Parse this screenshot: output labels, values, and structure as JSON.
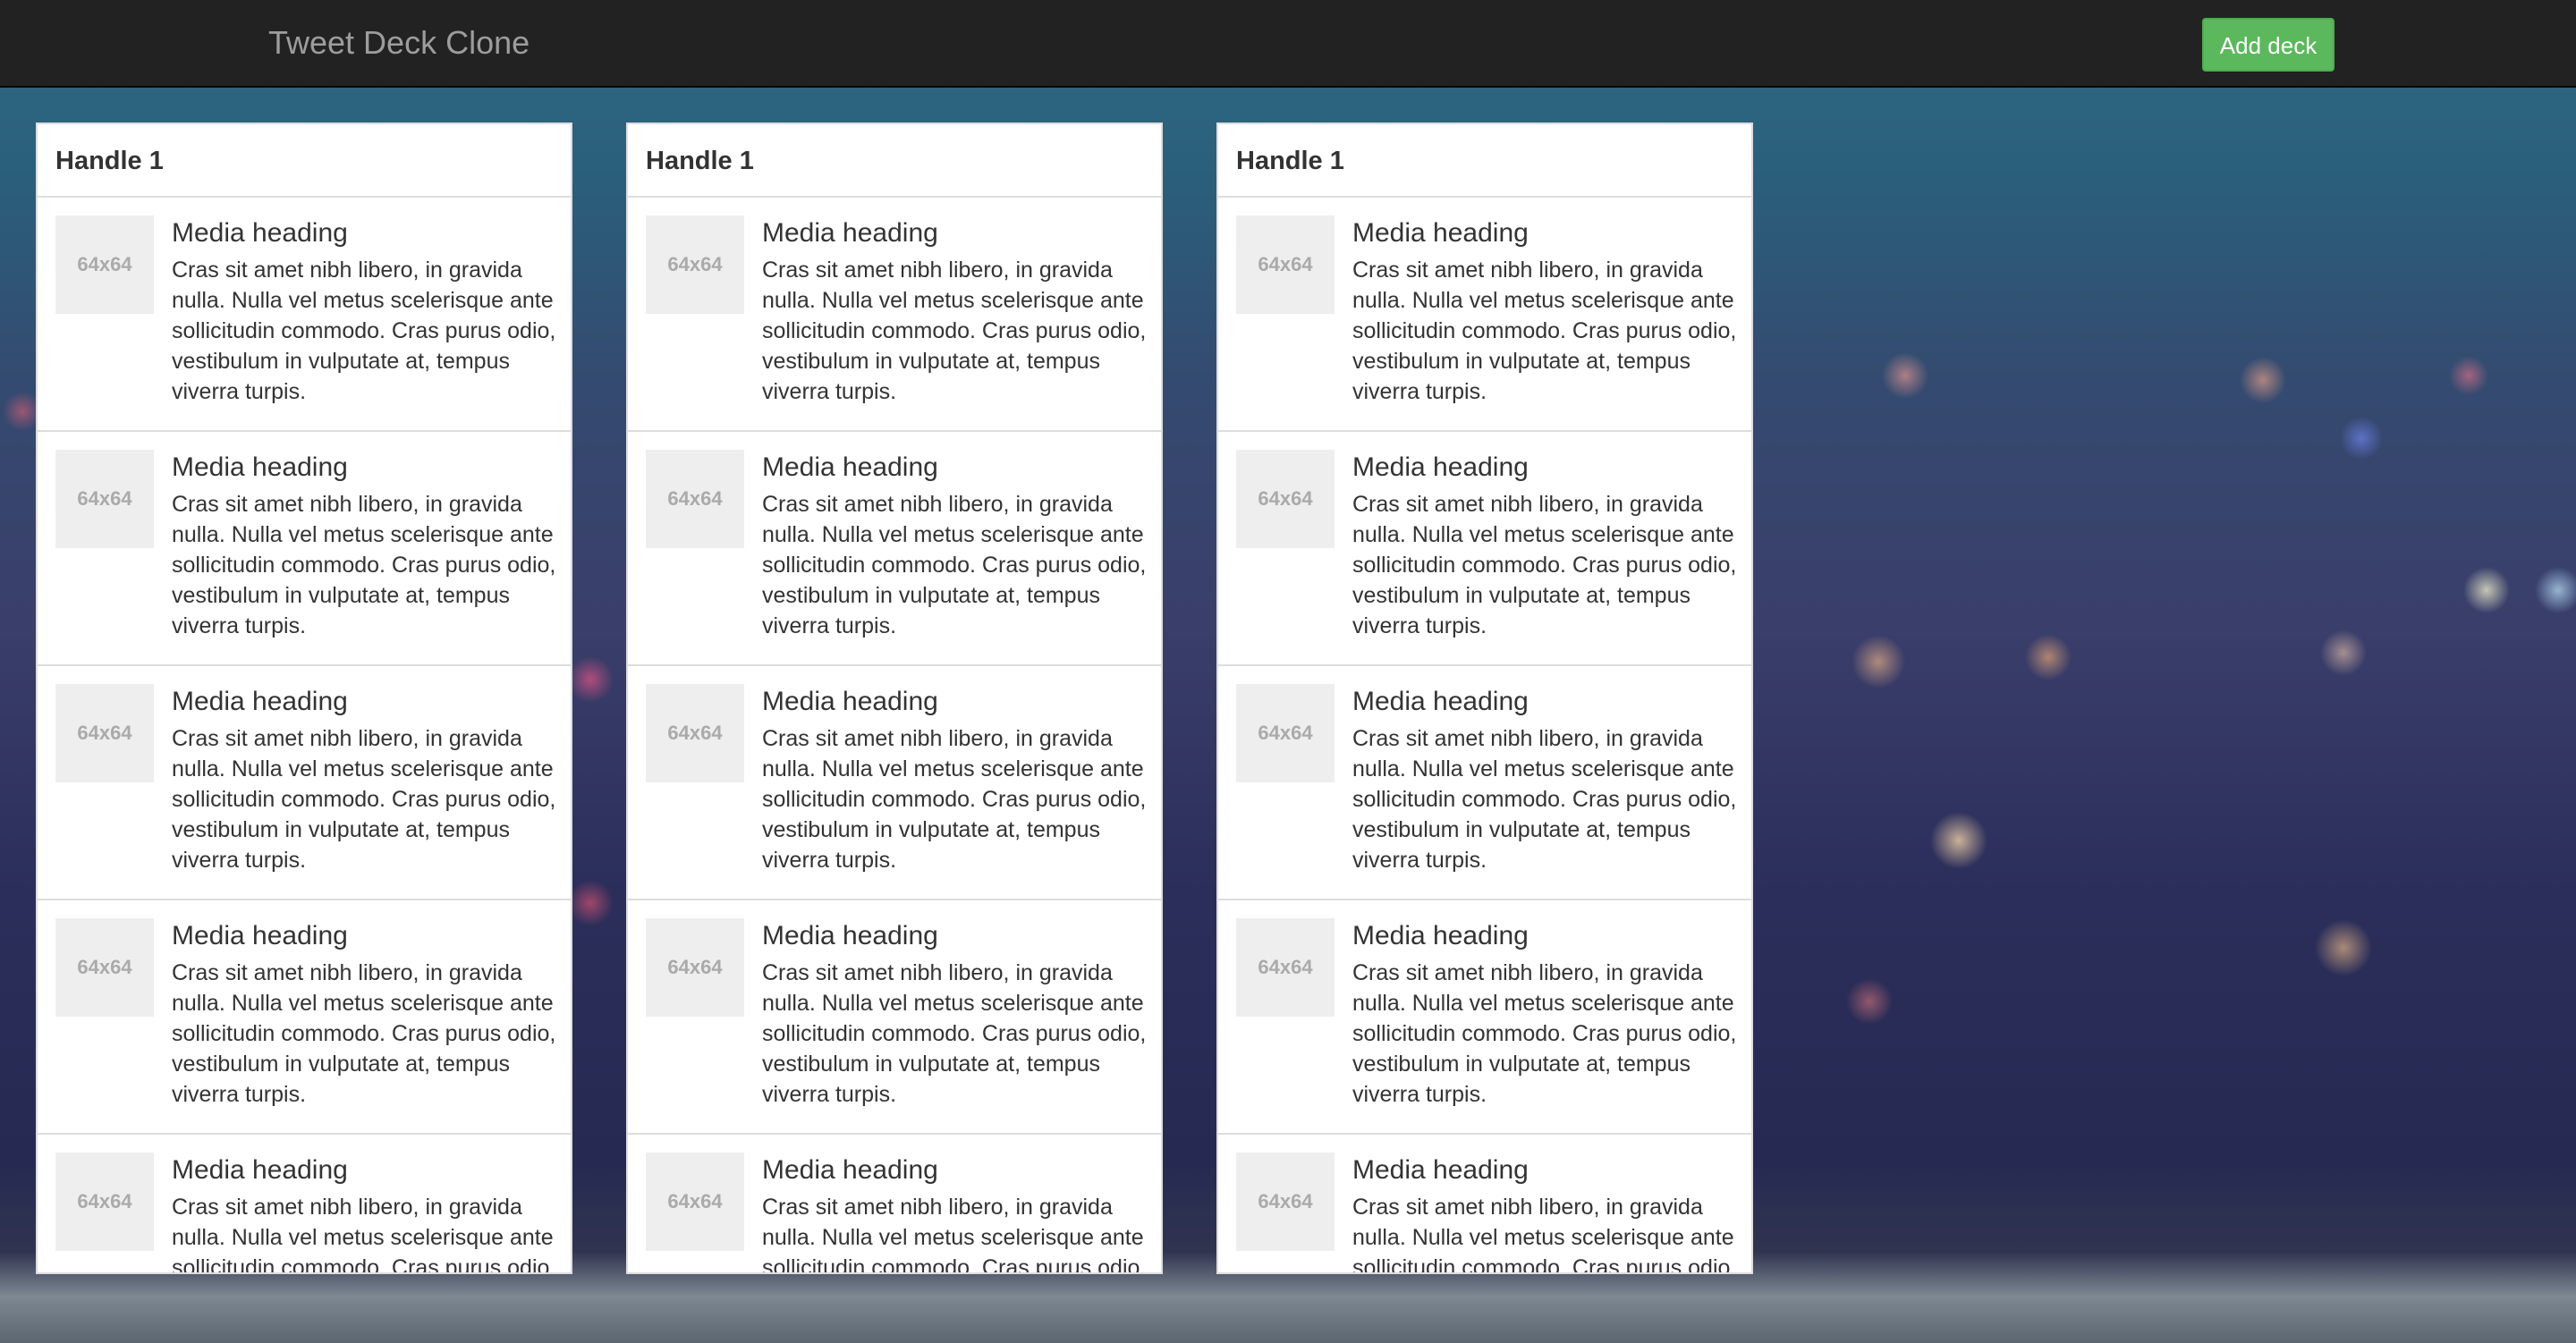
{
  "navbar": {
    "brand": "Tweet Deck Clone",
    "add_deck_label": "Add deck"
  },
  "colors": {
    "navbar_bg": "#222222",
    "brand_text": "#9d9d9d",
    "add_button_bg": "#5cb85c"
  },
  "decks": [
    {
      "handle": "Handle 1",
      "items": [
        {
          "thumb": "64x64",
          "heading": "Media heading",
          "text": "Cras sit amet nibh libero, in gravida nulla. Nulla vel metus scelerisque ante sollicitudin commodo. Cras purus odio, vestibulum in vulputate at, tempus viverra turpis."
        },
        {
          "thumb": "64x64",
          "heading": "Media heading",
          "text": "Cras sit amet nibh libero, in gravida nulla. Nulla vel metus scelerisque ante sollicitudin commodo. Cras purus odio, vestibulum in vulputate at, tempus viverra turpis."
        },
        {
          "thumb": "64x64",
          "heading": "Media heading",
          "text": "Cras sit amet nibh libero, in gravida nulla. Nulla vel metus scelerisque ante sollicitudin commodo. Cras purus odio, vestibulum in vulputate at, tempus viverra turpis."
        },
        {
          "thumb": "64x64",
          "heading": "Media heading",
          "text": "Cras sit amet nibh libero, in gravida nulla. Nulla vel metus scelerisque ante sollicitudin commodo. Cras purus odio, vestibulum in vulputate at, tempus viverra turpis."
        },
        {
          "thumb": "64x64",
          "heading": "Media heading",
          "text": "Cras sit amet nibh libero, in gravida nulla. Nulla vel metus scelerisque ante sollicitudin commodo. Cras purus odio, vestibulum in vulputate at, tempus viverra turpis."
        }
      ]
    },
    {
      "handle": "Handle 1",
      "items": [
        {
          "thumb": "64x64",
          "heading": "Media heading",
          "text": "Cras sit amet nibh libero, in gravida nulla. Nulla vel metus scelerisque ante sollicitudin commodo. Cras purus odio, vestibulum in vulputate at, tempus viverra turpis."
        },
        {
          "thumb": "64x64",
          "heading": "Media heading",
          "text": "Cras sit amet nibh libero, in gravida nulla. Nulla vel metus scelerisque ante sollicitudin commodo. Cras purus odio, vestibulum in vulputate at, tempus viverra turpis."
        },
        {
          "thumb": "64x64",
          "heading": "Media heading",
          "text": "Cras sit amet nibh libero, in gravida nulla. Nulla vel metus scelerisque ante sollicitudin commodo. Cras purus odio, vestibulum in vulputate at, tempus viverra turpis."
        },
        {
          "thumb": "64x64",
          "heading": "Media heading",
          "text": "Cras sit amet nibh libero, in gravida nulla. Nulla vel metus scelerisque ante sollicitudin commodo. Cras purus odio, vestibulum in vulputate at, tempus viverra turpis."
        },
        {
          "thumb": "64x64",
          "heading": "Media heading",
          "text": "Cras sit amet nibh libero, in gravida nulla. Nulla vel metus scelerisque ante sollicitudin commodo. Cras purus odio, vestibulum in vulputate at, tempus viverra turpis."
        }
      ]
    },
    {
      "handle": "Handle 1",
      "items": [
        {
          "thumb": "64x64",
          "heading": "Media heading",
          "text": "Cras sit amet nibh libero, in gravida nulla. Nulla vel metus scelerisque ante sollicitudin commodo. Cras purus odio, vestibulum in vulputate at, tempus viverra turpis."
        },
        {
          "thumb": "64x64",
          "heading": "Media heading",
          "text": "Cras sit amet nibh libero, in gravida nulla. Nulla vel metus scelerisque ante sollicitudin commodo. Cras purus odio, vestibulum in vulputate at, tempus viverra turpis."
        },
        {
          "thumb": "64x64",
          "heading": "Media heading",
          "text": "Cras sit amet nibh libero, in gravida nulla. Nulla vel metus scelerisque ante sollicitudin commodo. Cras purus odio, vestibulum in vulputate at, tempus viverra turpis."
        },
        {
          "thumb": "64x64",
          "heading": "Media heading",
          "text": "Cras sit amet nibh libero, in gravida nulla. Nulla vel metus scelerisque ante sollicitudin commodo. Cras purus odio, vestibulum in vulputate at, tempus viverra turpis."
        },
        {
          "thumb": "64x64",
          "heading": "Media heading",
          "text": "Cras sit amet nibh libero, in gravida nulla. Nulla vel metus scelerisque ante sollicitudin commodo. Cras purus odio, vestibulum in vulputate at, tempus viverra turpis."
        }
      ]
    }
  ]
}
